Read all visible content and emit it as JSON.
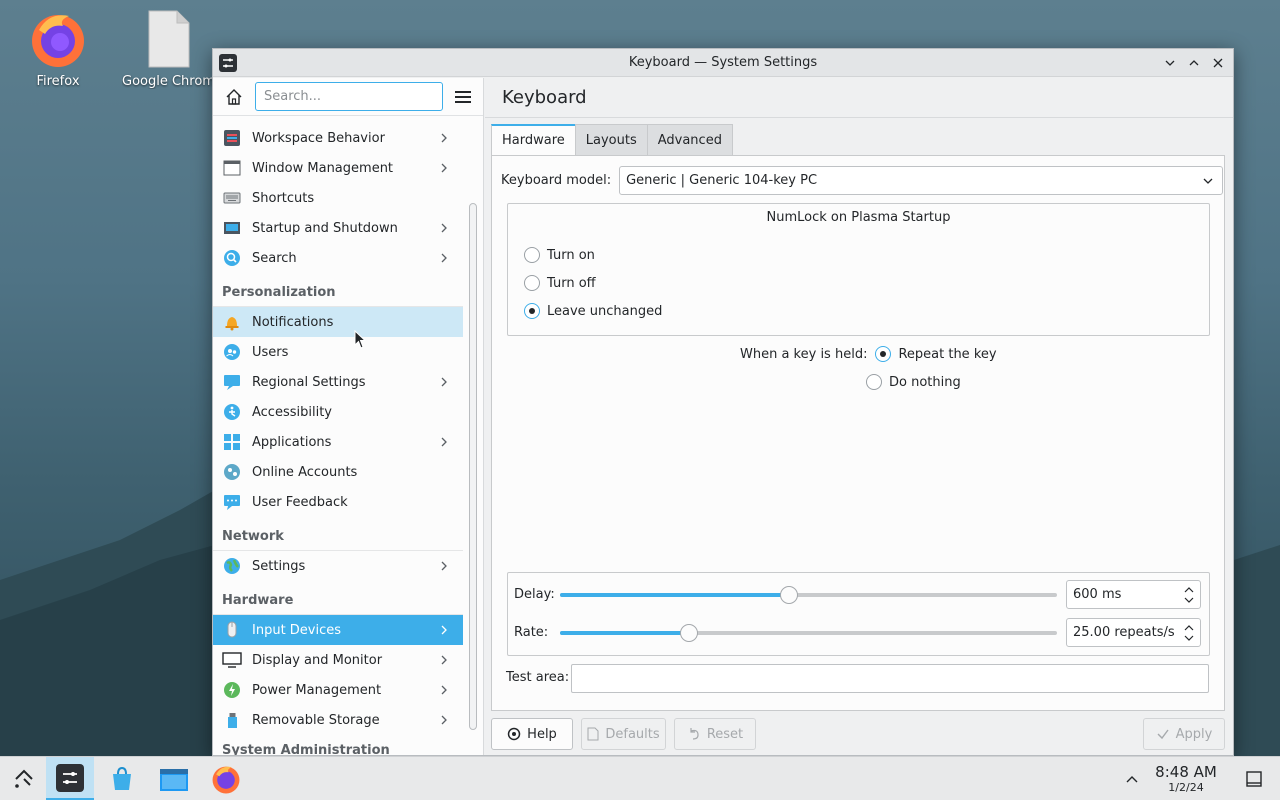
{
  "desktop": {
    "icons": [
      {
        "label": "Firefox"
      },
      {
        "label": "Google Chrome"
      }
    ]
  },
  "window": {
    "title": "Keyboard — System Settings"
  },
  "sidebar": {
    "search_placeholder": "Search...",
    "items": [
      {
        "label": "Workspace Behavior",
        "icon": "workspace-icon",
        "has_children": true
      },
      {
        "label": "Window Management",
        "icon": "window-icon",
        "has_children": true
      },
      {
        "label": "Shortcuts",
        "icon": "keyboard-icon",
        "has_children": false
      },
      {
        "label": "Startup and Shutdown",
        "icon": "startup-icon",
        "has_children": true
      },
      {
        "label": "Search",
        "icon": "search-icon",
        "has_children": true
      }
    ],
    "sections": {
      "personalization": "Personalization",
      "network": "Network",
      "hardware": "Hardware",
      "system_administration": "System Administration"
    },
    "personalization_items": [
      {
        "label": "Notifications",
        "icon": "bell-icon"
      },
      {
        "label": "Users",
        "icon": "users-icon"
      },
      {
        "label": "Regional Settings",
        "icon": "regional-icon"
      },
      {
        "label": "Accessibility",
        "icon": "accessibility-icon"
      },
      {
        "label": "Applications",
        "icon": "applications-icon"
      },
      {
        "label": "Online Accounts",
        "icon": "online-accounts-icon"
      },
      {
        "label": "User Feedback",
        "icon": "feedback-icon"
      }
    ],
    "network_items": [
      {
        "label": "Settings",
        "icon": "globe-icon"
      }
    ],
    "hardware_items": [
      {
        "label": "Input Devices",
        "icon": "mouse-icon"
      },
      {
        "label": "Display and Monitor",
        "icon": "monitor-icon"
      },
      {
        "label": "Power Management",
        "icon": "power-icon"
      },
      {
        "label": "Removable Storage",
        "icon": "usb-icon"
      }
    ]
  },
  "content": {
    "page_title": "Keyboard",
    "tabs": [
      "Hardware",
      "Layouts",
      "Advanced"
    ],
    "keyboard_model_label": "Keyboard model:",
    "keyboard_model_value": "Generic | Generic 104-key PC",
    "numlock": {
      "title": "NumLock on Plasma Startup",
      "options": [
        "Turn on",
        "Turn off",
        "Leave unchanged"
      ],
      "selected": "Leave unchanged"
    },
    "key_held": {
      "label": "When a key is held:",
      "options": [
        "Repeat the key",
        "Do nothing"
      ],
      "selected": "Repeat the key"
    },
    "delay": {
      "label": "Delay:",
      "value": "600 ms",
      "slider_fraction": 0.46
    },
    "rate": {
      "label": "Rate:",
      "value": "25.00 repeats/s",
      "slider_fraction": 0.26
    },
    "test_area_label": "Test area:",
    "buttons": {
      "help": "Help",
      "defaults": "Defaults",
      "reset": "Reset",
      "apply": "Apply"
    }
  },
  "taskbar": {
    "time": "8:48 AM",
    "date": "1/2/24"
  },
  "colors": {
    "accent": "#3daee9",
    "hover": "#cde8f6"
  }
}
